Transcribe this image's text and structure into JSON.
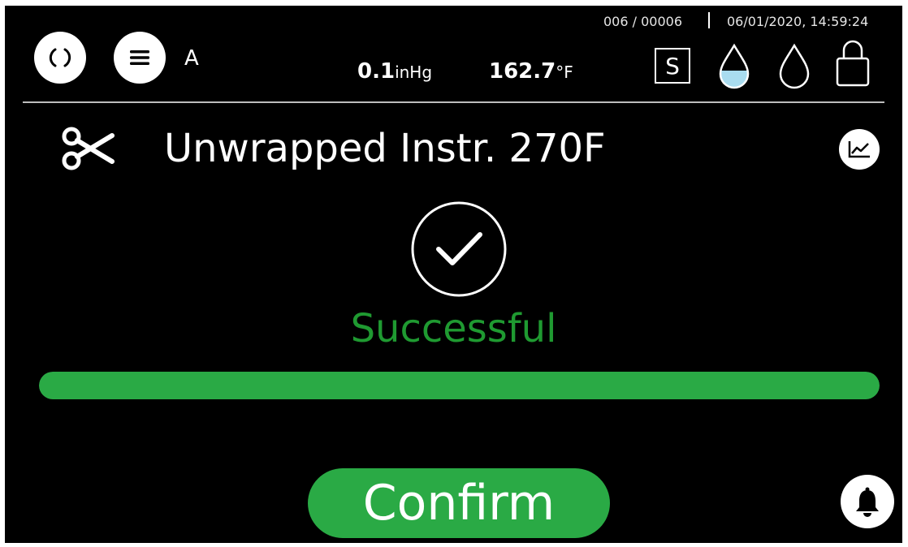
{
  "header": {
    "operator_label": "A",
    "cycle_counter": "006 / 00006",
    "separator": "|",
    "datetime": "06/01/2020, 14:59:24",
    "pressure": {
      "value": "0.1",
      "unit": "inHg"
    },
    "temperature": {
      "value": "162.7",
      "unit": "°F"
    },
    "s_indicator": "S",
    "icons": [
      "refresh-icon",
      "menu-icon",
      "water-level-icon",
      "water-drop-icon",
      "lock-icon"
    ]
  },
  "program": {
    "name": "Unwrapped Instr. 270F",
    "icon": "scissors-icon",
    "graph_icon": "line-chart-icon"
  },
  "status": {
    "icon": "check-circle-icon",
    "text": "Successful",
    "color": "#1f9a31",
    "progress": 1.0
  },
  "actions": {
    "confirm_label": "Confirm",
    "confirm_color": "#2aaa45",
    "bell_icon": "bell-icon"
  }
}
